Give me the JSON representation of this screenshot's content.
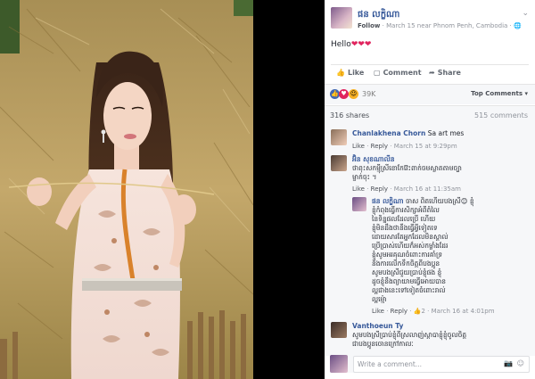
{
  "post": {
    "author": "ផន លក្ខិណា",
    "follow": "Follow",
    "meta": "· March 15 near Phnom Penh, Cambodia ·",
    "globe": "🌐",
    "text": "Hello",
    "hearts": "❤❤❤"
  },
  "actions": {
    "like": "Like",
    "comment": "Comment",
    "share": "Share"
  },
  "reactions": {
    "count": "39K",
    "top_comments": "Top Comments ▾"
  },
  "stats": {
    "shares": "316 shares",
    "comments": "515 comments"
  },
  "comments": [
    {
      "author": "Chanlakhena Chorn",
      "text": "Sa art mes",
      "like": "Like",
      "reply": "Reply",
      "time": "March 15 at 9:29pm"
    },
    {
      "author": "អ៊ិន សុខណាលីន",
      "text_line1": "ថាពុះសកម្ម៉ីស្រីខោកែវ៊េះពាក់ចមស្លាតតាមច្បា",
      "text_line2": "ម្ជាក់ចុះ ។",
      "like": "Like",
      "reply": "Reply",
      "time": "March 16 at 11:35am"
    },
    {
      "author": "ផន លក្ខិណា",
      "lines": [
        "ចាស ពិតហើយបងស្រី😊 ខ្ញុំ",
        "ខ្ញុំកំពុងធ្វើការសិក្សាអំពីតំលៃ",
        "នៃទិន្នផលដែលប្រើ ហើយ",
        "ខ្ញុំមិនដឹងថានឹងធ្វើអ្វីទៀតទេ",
        "ដោយសារតែអ្នកដែលមិនស្គាល់",
        "ប្រើប្រាស់ហើយក៏អស់កម្លាំងដែរ",
        "ខ្ញុំសូមអរគុណចំពោះការគាំទ្រ",
        "និងការលើកទឹកចិត្តពីបងប្អូន",
        "សូមបងស្រីជួយប្រាប់ខ្ញុំផង ខ្ញុំ",
        "ដូចខ្ញុំនឹងព្យាយាមធ្វើអោយបាន",
        "ល្អជាងនេះទៅទៀតចំពោះរាល់",
        "ល្អម្ម៉ោ"
      ],
      "like": "Like",
      "reply": "Reply",
      "likes_count": "2",
      "time": "March 16 at 4:01pm"
    },
    {
      "author": "Vanthoeun Ty",
      "text_line1": "សូមបងស្រីប្រាប់ខ្ញុំពីស្រលាញ់ស្តាបាខ្ញុំខ្ញុំចូលចិត្ត",
      "text_line2": "ជាបងប្អូនចោនក្រៅកាលៈ"
    }
  ],
  "write": {
    "placeholder": "Write a comment..."
  },
  "colors": {
    "link_blue": "#365899",
    "like_blue": "#4267b2",
    "love_red": "#e0245e"
  }
}
